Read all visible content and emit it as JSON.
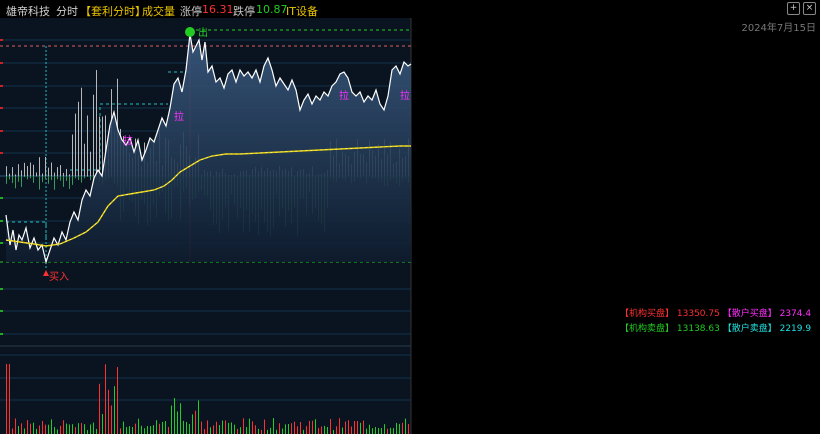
{
  "header": {
    "stock_name": "雄帝科技",
    "mode": "分时",
    "indicator": "【套利分时】",
    "volume_label": "成交量",
    "limit_up_label": "涨停",
    "limit_up_value": "16.31",
    "limit_down_label": "跌停",
    "limit_down_value": "10.87",
    "sector": "IT设备",
    "date": "2024年7月15日"
  },
  "window_controls": {
    "add": "+",
    "close": "×"
  },
  "annotations": {
    "buy_marker": "买入",
    "top_marker": "出",
    "pull_1": "拉",
    "pull_2": "拉",
    "pull_3": "拉",
    "pull_4": "拉"
  },
  "legend": {
    "inst_buy_label": "【机构买盘】",
    "inst_buy_value": "13350.75",
    "retail_buy_label": "【散户买盘】",
    "retail_buy_value": "2374.4",
    "inst_sell_label": "【机构卖盘】",
    "inst_sell_value": "13138.63",
    "retail_sell_label": "【散户卖盘】",
    "retail_sell_value": "2219.9"
  },
  "colors": {
    "price_line": "#ffffff",
    "avg_line": "#e8d000",
    "up": "#ff3030",
    "down": "#22cc22",
    "grid": "#1a3c5a",
    "accent_yellow": "#e8c400",
    "cyan": "#20e0e0",
    "magenta": "#ff30ff"
  }
}
